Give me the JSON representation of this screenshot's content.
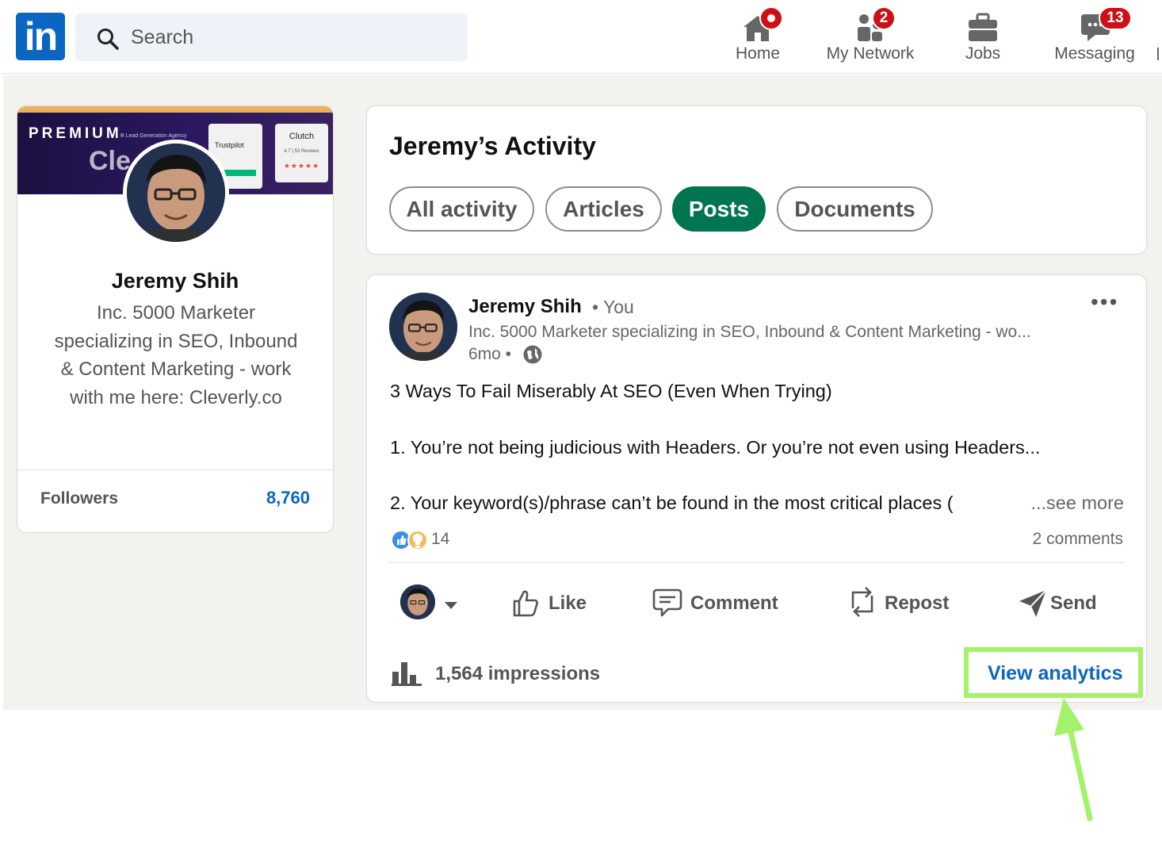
{
  "nav": {
    "logo_text": "in",
    "search_placeholder": "Search",
    "items": [
      {
        "label": "Home",
        "icon": "home-icon",
        "badge": ""
      },
      {
        "label": "My Network",
        "icon": "network-icon",
        "badge": "2"
      },
      {
        "label": "Jobs",
        "icon": "briefcase-icon",
        "badge": ""
      },
      {
        "label": "Messaging",
        "icon": "messaging-icon",
        "badge": "13"
      }
    ]
  },
  "profile": {
    "banner_label": "PREMIUM",
    "banner_small": "B Lead Generation Agency",
    "banner_brand": "Cle",
    "trustpilot": "Trustpilot",
    "clutch": "Clutch",
    "clutch_rating": "4.7 | 53 Reviews",
    "clutch_stars": "★★★★★",
    "name": "Jeremy Shih",
    "headline": "Inc. 5000 Marketer specializing in SEO, Inbound & Content Marketing - work with me here: Cleverly.co",
    "followers_label": "Followers",
    "followers_value": "8,760"
  },
  "activity": {
    "title": "Jeremy’s Activity",
    "filters": [
      {
        "label": "All activity",
        "active": false
      },
      {
        "label": "Articles",
        "active": false
      },
      {
        "label": "Posts",
        "active": true
      },
      {
        "label": "Documents",
        "active": false
      }
    ]
  },
  "post": {
    "author": "Jeremy Shih",
    "author_tag": "• You",
    "headline": "Inc. 5000 Marketer specializing in SEO, Inbound & Content Marketing - wo...",
    "time": "6mo •",
    "lines": [
      "3 Ways To Fail Miserably At SEO (Even When Trying)",
      "1. You’re not being judicious with Headers. Or you’re not even using Headers...",
      "2. Your keyword(s)/phrase can’t be found in the most critical places ("
    ],
    "see_more": "...see more",
    "reactions_count": "14",
    "comments": "2 comments",
    "actions": {
      "like": "Like",
      "comment": "Comment",
      "repost": "Repost",
      "send": "Send"
    },
    "impressions": "1,564 impressions",
    "view_analytics": "View analytics"
  },
  "colors": {
    "brand": "#0a66c2",
    "active_pill": "#01754f",
    "highlight": "#a2f36b",
    "badge": "#cc1016"
  }
}
